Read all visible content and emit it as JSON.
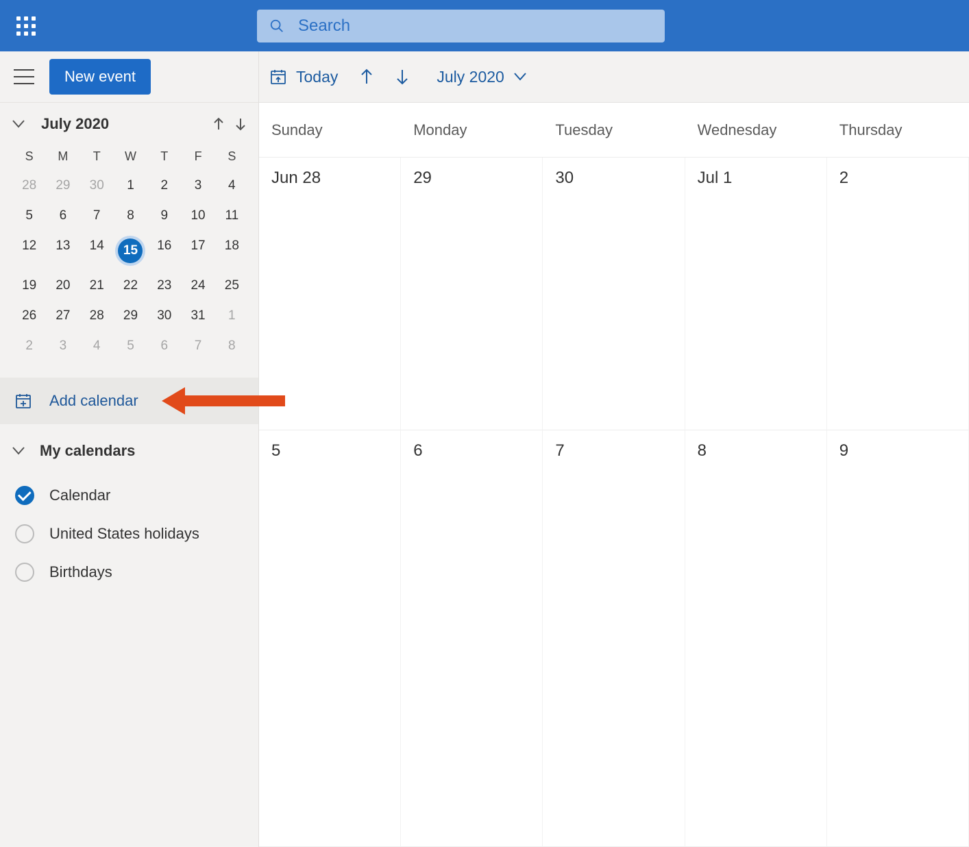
{
  "header": {
    "search_placeholder": "Search"
  },
  "sidebar": {
    "new_event_label": "New event",
    "mini_cal": {
      "title": "July 2020",
      "dow": [
        "S",
        "M",
        "T",
        "W",
        "T",
        "F",
        "S"
      ],
      "weeks": [
        [
          {
            "n": "28",
            "dim": true
          },
          {
            "n": "29",
            "dim": true
          },
          {
            "n": "30",
            "dim": true
          },
          {
            "n": "1"
          },
          {
            "n": "2"
          },
          {
            "n": "3"
          },
          {
            "n": "4"
          }
        ],
        [
          {
            "n": "5"
          },
          {
            "n": "6"
          },
          {
            "n": "7"
          },
          {
            "n": "8"
          },
          {
            "n": "9"
          },
          {
            "n": "10"
          },
          {
            "n": "11"
          }
        ],
        [
          {
            "n": "12"
          },
          {
            "n": "13"
          },
          {
            "n": "14"
          },
          {
            "n": "15",
            "sel": true
          },
          {
            "n": "16"
          },
          {
            "n": "17"
          },
          {
            "n": "18"
          }
        ],
        [
          {
            "n": "19"
          },
          {
            "n": "20"
          },
          {
            "n": "21"
          },
          {
            "n": "22"
          },
          {
            "n": "23"
          },
          {
            "n": "24"
          },
          {
            "n": "25"
          }
        ],
        [
          {
            "n": "26"
          },
          {
            "n": "27"
          },
          {
            "n": "28"
          },
          {
            "n": "29"
          },
          {
            "n": "30"
          },
          {
            "n": "31"
          },
          {
            "n": "1",
            "dim": true
          }
        ],
        [
          {
            "n": "2",
            "dim": true
          },
          {
            "n": "3",
            "dim": true
          },
          {
            "n": "4",
            "dim": true
          },
          {
            "n": "5",
            "dim": true
          },
          {
            "n": "6",
            "dim": true
          },
          {
            "n": "7",
            "dim": true
          },
          {
            "n": "8",
            "dim": true
          }
        ]
      ]
    },
    "add_calendar_label": "Add calendar",
    "my_calendars_label": "My calendars",
    "calendars": [
      {
        "label": "Calendar",
        "checked": true
      },
      {
        "label": "United States holidays",
        "checked": false
      },
      {
        "label": "Birthdays",
        "checked": false
      }
    ]
  },
  "toolbar": {
    "today_label": "Today",
    "month_label": "July 2020"
  },
  "grid": {
    "dow": [
      "Sunday",
      "Monday",
      "Tuesday",
      "Wednesday",
      "Thursday"
    ],
    "rows": [
      [
        "Jun 28",
        "29",
        "30",
        "Jul 1",
        "2"
      ],
      [
        "5",
        "6",
        "7",
        "8",
        "9"
      ]
    ]
  }
}
